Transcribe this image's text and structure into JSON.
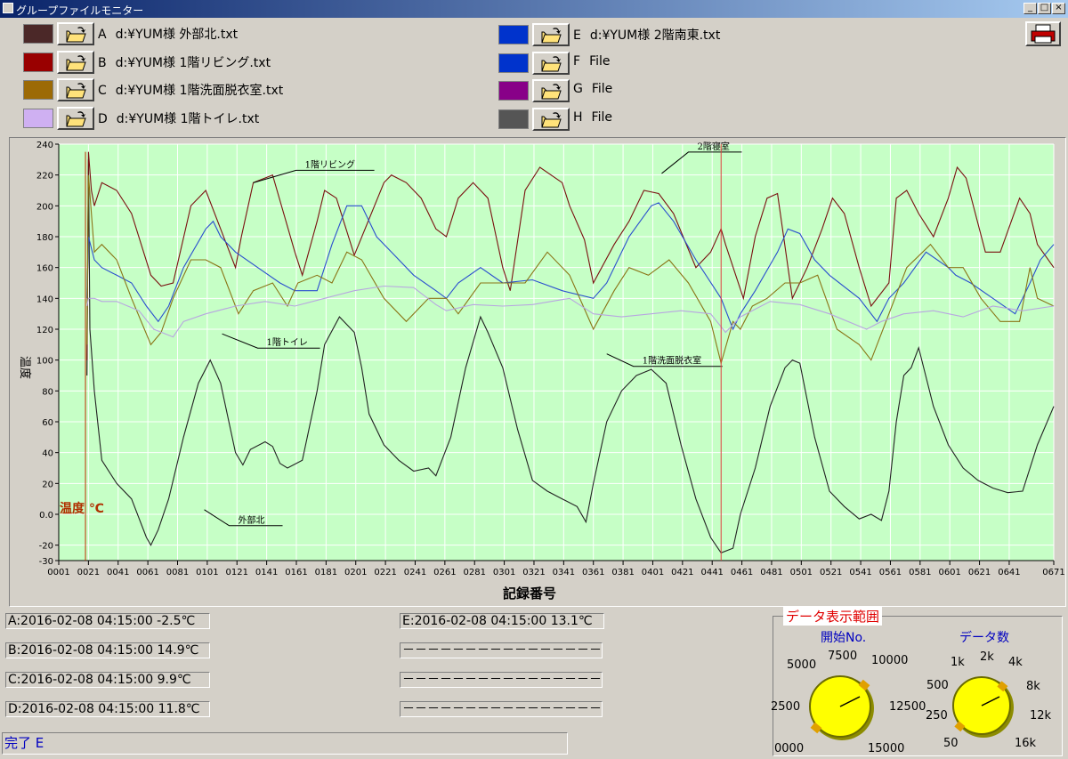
{
  "window": {
    "title": "グループファイルモニター",
    "minimize": "_",
    "restore": "□",
    "close": "×"
  },
  "icons": {
    "open_folder": "open-folder-icon",
    "print": "printer-icon"
  },
  "files_left": [
    {
      "letter": "A",
      "path": "d:¥YUM様  外部北.txt",
      "color": "#4b2828"
    },
    {
      "letter": "B",
      "path": "d:¥YUM様  1階リビング.txt",
      "color": "#990000"
    },
    {
      "letter": "C",
      "path": "d:¥YUM様  1階洗面脱衣室.txt",
      "color": "#9c6a06"
    },
    {
      "letter": "D",
      "path": "d:¥YUM様  1階トイレ.txt",
      "color": "#cfb0f2"
    }
  ],
  "files_right": [
    {
      "letter": "E",
      "path": "d:¥YUM様  2階南東.txt",
      "color": "#0033cc"
    },
    {
      "letter": "F",
      "path": "File",
      "color": "#0033cc"
    },
    {
      "letter": "G",
      "path": "File",
      "color": "#880088"
    },
    {
      "letter": "H",
      "path": "File",
      "color": "#555555"
    }
  ],
  "chart_data": {
    "type": "line",
    "ylabel": "温度",
    "xlabel": "記録番号",
    "unit_note": "温度 ℃",
    "ylim": [
      -30,
      240
    ],
    "xlim": [
      1,
      671
    ],
    "yticks": [
      "240",
      "220",
      "200",
      "180",
      "160",
      "140",
      "120",
      "100",
      "80",
      "60",
      "40",
      "20",
      "0.0",
      "-20",
      "-30"
    ],
    "ytick_values": [
      240,
      220,
      200,
      180,
      160,
      140,
      120,
      100,
      80,
      60,
      40,
      20,
      0,
      -20,
      -30
    ],
    "xticks": [
      "0001",
      "0021",
      "0041",
      "0061",
      "0081",
      "0101",
      "0121",
      "0141",
      "0161",
      "0181",
      "0201",
      "0221",
      "0241",
      "0261",
      "0281",
      "0301",
      "0321",
      "0341",
      "0361",
      "0381",
      "0401",
      "0421",
      "0441",
      "0461",
      "0481",
      "0501",
      "0521",
      "0541",
      "0561",
      "0581",
      "0601",
      "0621",
      "0641",
      "0671"
    ],
    "xtick_values": [
      1,
      21,
      41,
      61,
      81,
      101,
      121,
      141,
      161,
      181,
      201,
      221,
      241,
      261,
      281,
      301,
      321,
      341,
      361,
      381,
      401,
      421,
      441,
      461,
      481,
      501,
      521,
      541,
      561,
      581,
      601,
      621,
      641,
      671
    ],
    "grid": true,
    "cursor_x": 447,
    "annotations": [
      {
        "text": "1階リビング",
        "x": 132,
        "y": 215
      },
      {
        "text": "2階寝室",
        "x": 407,
        "y": 221
      },
      {
        "text": "1階トイレ",
        "x": 111,
        "y": 117
      },
      {
        "text": "1階洗面脱衣室",
        "x": 370,
        "y": 104
      },
      {
        "text": "外部北",
        "x": 99,
        "y": 3
      }
    ],
    "series": [
      {
        "color": "#222222",
        "x": [
          1,
          18,
          20,
          21,
          22,
          25,
          30,
          40,
          50,
          60,
          63,
          68,
          75,
          85,
          95,
          103,
          110,
          120,
          125,
          130,
          140,
          145,
          150,
          155,
          165,
          175,
          180,
          190,
          200,
          205,
          210,
          220,
          230,
          240,
          250,
          255,
          265,
          275,
          285,
          290,
          300,
          310,
          320,
          330,
          340,
          350,
          356,
          361,
          370,
          380,
          390,
          400,
          410,
          420,
          430,
          440,
          447,
          455,
          460,
          470,
          480,
          490,
          495,
          500,
          510,
          520,
          530,
          540,
          548,
          555,
          560,
          565,
          570,
          575,
          580,
          590,
          600,
          610,
          620,
          630,
          640,
          650,
          660,
          671
        ],
        "y": [
          null,
          null,
          90,
          230,
          120,
          80,
          35,
          20,
          10,
          -15,
          -20,
          -10,
          10,
          50,
          85,
          100,
          85,
          40,
          32,
          42,
          47,
          44,
          33,
          30,
          35,
          80,
          110,
          128,
          118,
          95,
          65,
          45,
          35,
          28,
          30,
          25,
          50,
          95,
          128,
          118,
          95,
          55,
          22,
          15,
          10,
          5,
          -5,
          20,
          60,
          80,
          90,
          94,
          85,
          45,
          10,
          -15,
          -25,
          -22,
          0,
          30,
          70,
          95,
          100,
          98,
          50,
          15,
          5,
          -3,
          0,
          -4,
          15,
          60,
          90,
          95,
          108,
          70,
          45,
          30,
          22,
          17,
          14,
          15,
          45,
          70
        ]
      },
      {
        "color": "#7a1010",
        "x": [
          1,
          18,
          20,
          21,
          23,
          25,
          30,
          40,
          50,
          63,
          70,
          78,
          90,
          100,
          110,
          120,
          124,
          132,
          145,
          160,
          165,
          175,
          180,
          188,
          200,
          220,
          225,
          235,
          245,
          255,
          262,
          270,
          280,
          290,
          300,
          305,
          315,
          325,
          340,
          345,
          355,
          361,
          375,
          385,
          395,
          405,
          415,
          430,
          440,
          447,
          450,
          462,
          470,
          478,
          485,
          495,
          505,
          515,
          522,
          530,
          540,
          548,
          560,
          565,
          572,
          580,
          590,
          600,
          606,
          612,
          625,
          635,
          648,
          655,
          660,
          671
        ],
        "y": [
          null,
          null,
          100,
          235,
          210,
          200,
          215,
          210,
          195,
          155,
          148,
          150,
          200,
          210,
          185,
          160,
          180,
          215,
          220,
          170,
          155,
          190,
          210,
          205,
          168,
          215,
          220,
          215,
          205,
          185,
          180,
          205,
          215,
          205,
          160,
          145,
          210,
          225,
          215,
          200,
          178,
          150,
          175,
          190,
          210,
          208,
          195,
          160,
          170,
          185,
          175,
          140,
          180,
          205,
          208,
          140,
          160,
          185,
          205,
          195,
          160,
          135,
          150,
          205,
          210,
          195,
          180,
          205,
          225,
          218,
          170,
          170,
          205,
          195,
          175,
          160
        ]
      },
      {
        "color": "#2a4ecf",
        "x": [
          1,
          18,
          20,
          21,
          25,
          30,
          40,
          50,
          60,
          68,
          75,
          85,
          100,
          105,
          110,
          120,
          135,
          150,
          160,
          175,
          185,
          195,
          205,
          215,
          225,
          240,
          255,
          262,
          270,
          285,
          300,
          320,
          340,
          361,
          370,
          385,
          400,
          405,
          415,
          430,
          447,
          455,
          460,
          470,
          485,
          492,
          500,
          510,
          520,
          540,
          552,
          560,
          570,
          585,
          600,
          605,
          615,
          630,
          645,
          655,
          662,
          671
        ],
        "y": [
          null,
          null,
          140,
          180,
          165,
          160,
          155,
          150,
          135,
          125,
          135,
          160,
          185,
          190,
          180,
          170,
          160,
          150,
          145,
          145,
          175,
          200,
          200,
          180,
          170,
          155,
          145,
          140,
          150,
          160,
          150,
          152,
          145,
          140,
          150,
          180,
          200,
          202,
          190,
          165,
          140,
          120,
          130,
          145,
          170,
          185,
          182,
          165,
          155,
          140,
          125,
          140,
          150,
          170,
          160,
          155,
          150,
          140,
          130,
          150,
          165,
          175
        ]
      },
      {
        "color": "#8a7416",
        "x": [
          1,
          18,
          20,
          21,
          25,
          30,
          40,
          50,
          63,
          70,
          78,
          90,
          100,
          110,
          122,
          132,
          145,
          155,
          162,
          175,
          185,
          195,
          205,
          220,
          235,
          250,
          262,
          270,
          285,
          300,
          315,
          330,
          345,
          361,
          375,
          385,
          398,
          412,
          425,
          440,
          447,
          455,
          460,
          468,
          478,
          490,
          500,
          512,
          525,
          540,
          548,
          560,
          572,
          588,
          600,
          610,
          622,
          635,
          648,
          655,
          660,
          671
        ],
        "y": [
          null,
          null,
          110,
          220,
          170,
          175,
          165,
          140,
          110,
          118,
          140,
          165,
          165,
          160,
          130,
          145,
          150,
          135,
          150,
          155,
          150,
          170,
          165,
          140,
          125,
          140,
          140,
          130,
          150,
          150,
          150,
          170,
          155,
          120,
          145,
          160,
          155,
          165,
          150,
          125,
          98,
          125,
          120,
          135,
          140,
          150,
          150,
          155,
          120,
          110,
          100,
          130,
          160,
          175,
          160,
          160,
          140,
          125,
          125,
          160,
          140,
          135
        ]
      },
      {
        "color": "#b8a6e0",
        "x": [
          1,
          18,
          20,
          21,
          25,
          30,
          40,
          55,
          65,
          78,
          85,
          100,
          120,
          140,
          160,
          180,
          200,
          220,
          240,
          255,
          262,
          280,
          300,
          320,
          345,
          361,
          380,
          400,
          420,
          440,
          450,
          460,
          480,
          500,
          520,
          545,
          555,
          570,
          590,
          610,
          630,
          650,
          671
        ],
        "y": [
          null,
          null,
          135,
          140,
          140,
          138,
          138,
          132,
          120,
          115,
          125,
          130,
          135,
          138,
          135,
          140,
          145,
          148,
          147,
          136,
          132,
          136,
          135,
          136,
          140,
          130,
          128,
          130,
          132,
          130,
          118,
          128,
          138,
          136,
          130,
          120,
          125,
          130,
          132,
          128,
          135,
          132,
          135
        ]
      }
    ]
  },
  "readouts": {
    "A": "A:2016-02-08 04:15:00 -2.5℃",
    "B": "B:2016-02-08 04:15:00 14.9℃",
    "C": "C:2016-02-08 04:15:00  9.9℃",
    "D": "D:2016-02-08 04:15:00 11.8℃",
    "E": "E:2016-02-08 04:15:00 13.1℃",
    "F": "－－－－－－－－－－－－－－－－－",
    "G": "－－－－－－－－－－－－－－－－－",
    "H": "－－－－－－－－－－－－－－－－－"
  },
  "status": "完了 E",
  "range": {
    "title": "データ表示範囲",
    "start_label": "開始No.",
    "count_label": "データ数",
    "start_ticks": [
      "0000",
      "2500",
      "5000",
      "7500",
      "10000",
      "12500",
      "15000"
    ],
    "count_ticks": [
      "50",
      "250",
      "500",
      "1k",
      "2k",
      "4k",
      "8k",
      "12k",
      "16k"
    ],
    "knob_color": "#ffff00"
  }
}
